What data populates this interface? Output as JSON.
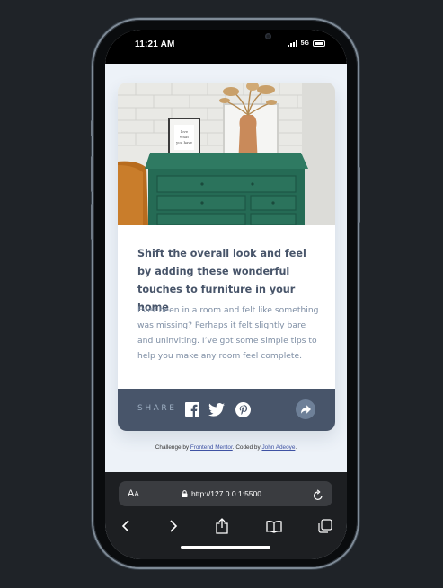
{
  "status_bar": {
    "time": "11:21 AM",
    "network": "5G"
  },
  "article": {
    "headline": "Shift the overall look and feel by adding these wonderful touches to furniture in your home",
    "body": "Ever been in a room and felt like something was missing? Perhaps it felt slightly bare and uninviting. I’ve got some simple tips to help you make any room feel complete.",
    "frame_text": "love what you have"
  },
  "share": {
    "label": "SHARE",
    "icons": [
      "facebook-icon",
      "twitter-icon",
      "pinterest-icon",
      "share-icon"
    ]
  },
  "credit": {
    "prefix": "Challenge by ",
    "frontend_link": "Frontend Mentor",
    "middle": ". Coded by ",
    "author_link": "John Adeoye",
    "suffix": "."
  },
  "browser": {
    "text_size_label_big": "A",
    "text_size_label_small": "A",
    "url": "http://127.0.0.1:5500"
  },
  "colors": {
    "dark_blue": "#48556a",
    "desaturated_blue": "#6e8098",
    "grayish_blue": "#9daec2",
    "light_bg": "#ecf2f8"
  }
}
